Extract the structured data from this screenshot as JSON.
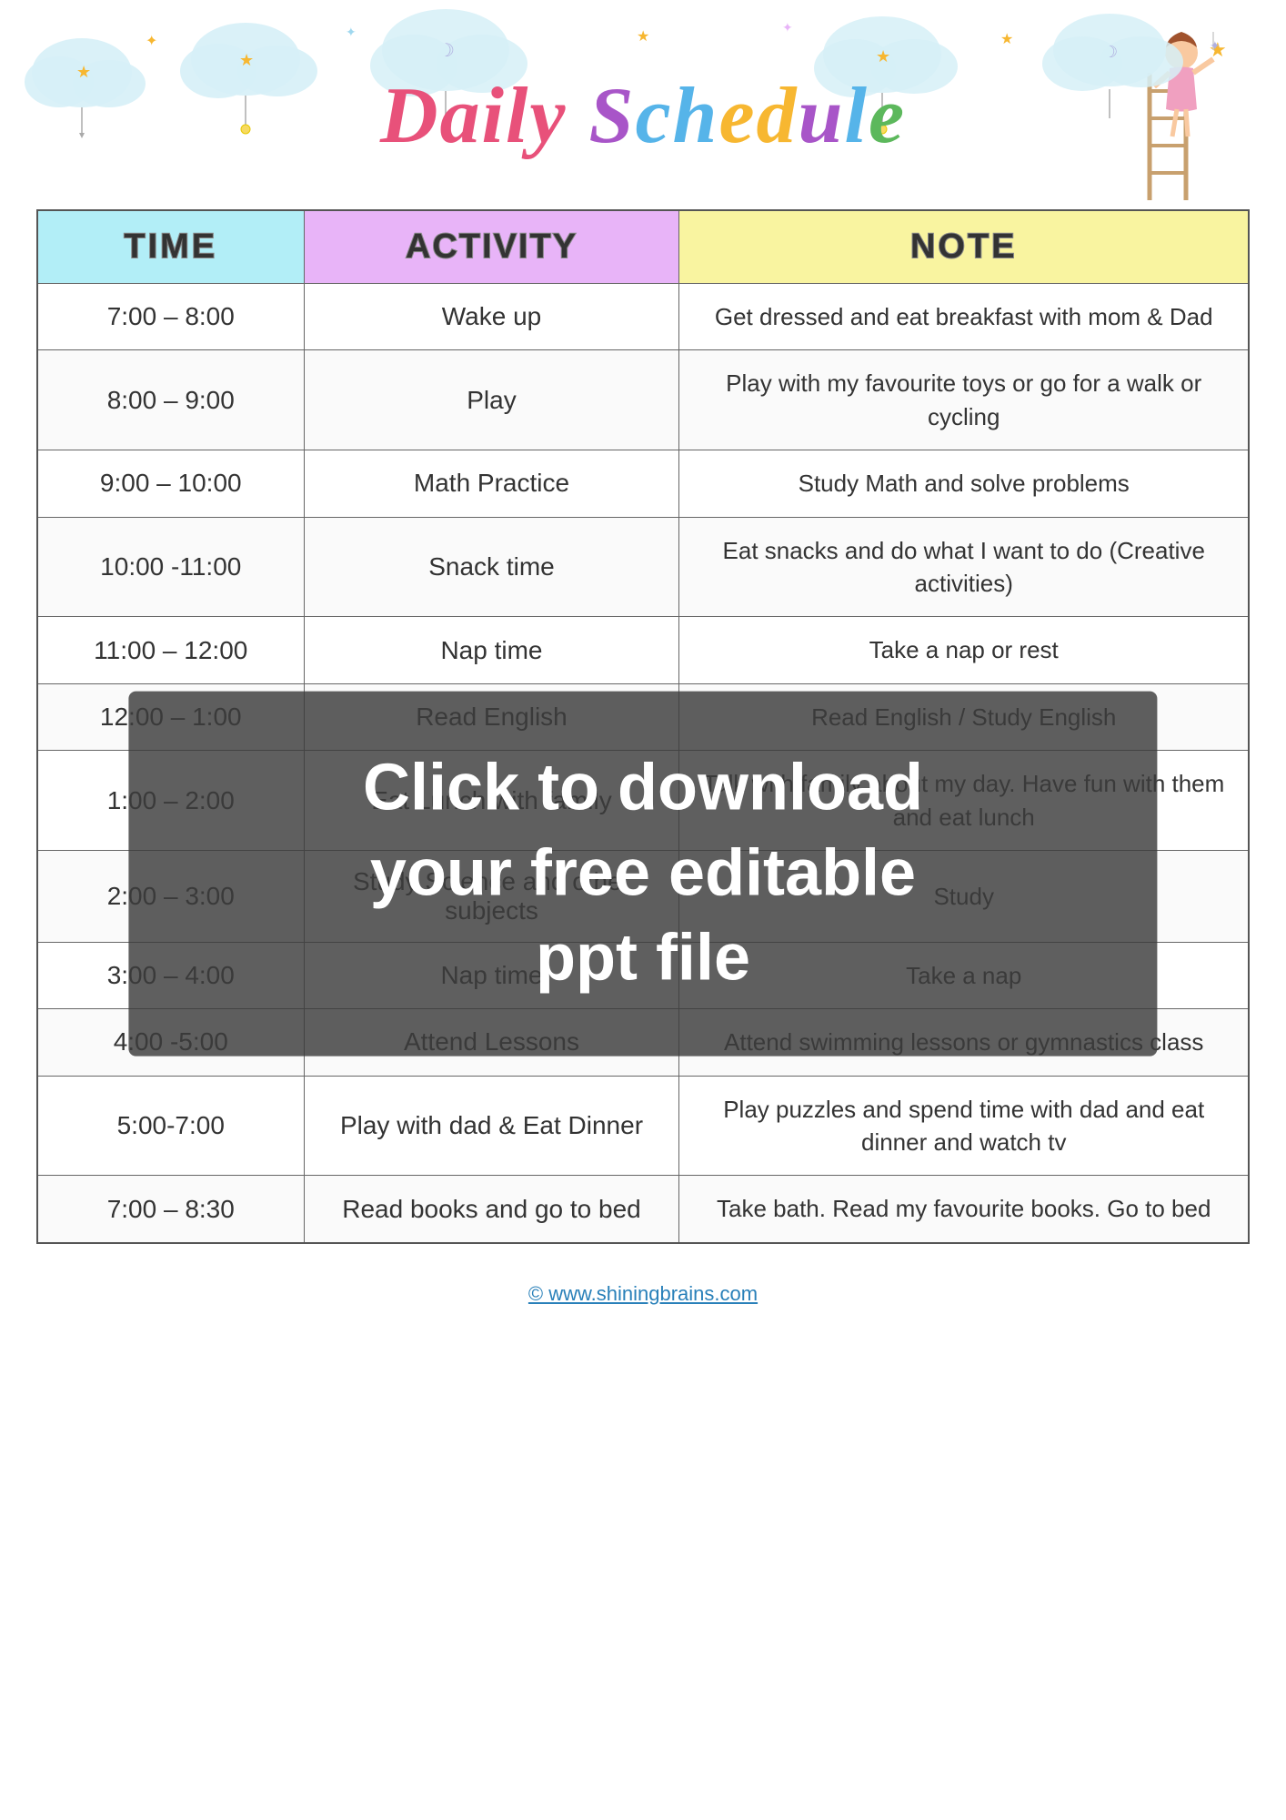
{
  "header": {
    "title_part1": "Daily",
    "title_part2": "Schedule",
    "website": "© www.shiningbrains.com"
  },
  "table": {
    "headers": {
      "time": "TIME",
      "activity": "ACTIVITY",
      "note": "NOTE"
    },
    "rows": [
      {
        "time": "7:00 – 8:00",
        "activity": "Wake up",
        "note": "Get dressed and eat breakfast with mom & Dad"
      },
      {
        "time": "8:00 – 9:00",
        "activity": "Play",
        "note": "Play with my favourite toys or go for a walk or cycling"
      },
      {
        "time": "9:00 – 10:00",
        "activity": "Math Practice",
        "note": "Study Math and solve problems"
      },
      {
        "time": "10:00 -11:00",
        "activity": "Snack time",
        "note": "Eat snacks and do what I want to do (Creative activities)"
      },
      {
        "time": "11:00 – 12:00",
        "activity": "Nap time",
        "note": "Take a nap or rest"
      },
      {
        "time": "12:00 – 1:00",
        "activity": "Read English",
        "note": "Read English / Study English"
      },
      {
        "time": "1:00 – 2:00",
        "activity": "Eat Lunch with family",
        "note": "Talk with family about my day. Have fun with them and eat lunch"
      },
      {
        "time": "2:00 – 3:00",
        "activity": "Study Science and other subjects",
        "note": "Study"
      },
      {
        "time": "3:00 – 4:00",
        "activity": "Nap time",
        "note": "Take a nap"
      },
      {
        "time": "4:00 -5:00",
        "activity": "Attend Lessons",
        "note": "Attend swimming lessons or gymnastics class"
      },
      {
        "time": "5:00-7:00",
        "activity": "Play with dad & Eat Dinner",
        "note": "Play puzzles and spend time with dad and eat dinner and watch tv"
      },
      {
        "time": "7:00 – 8:30",
        "activity": "Read books and go to bed",
        "note": "Take bath. Read my favourite books. Go to bed"
      }
    ]
  },
  "watermark": {
    "line1": "Click to download",
    "line2": "your free editable",
    "line3": "ppt file"
  }
}
